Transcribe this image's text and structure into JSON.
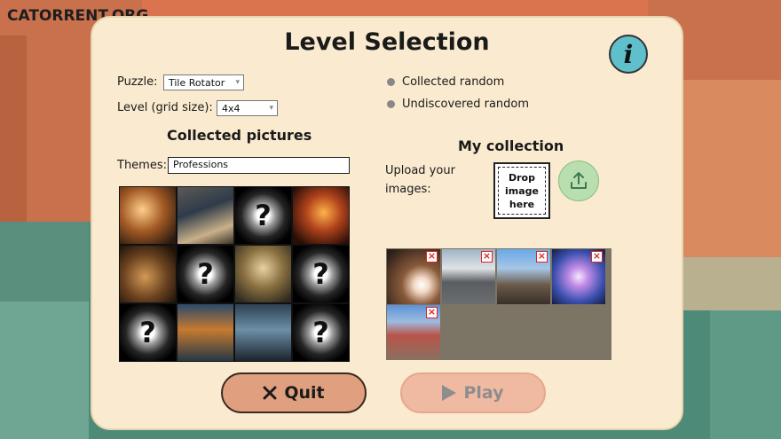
{
  "logo": "CATORRENT.ORG",
  "title": "Level Selection",
  "info_icon": "i",
  "puzzle": {
    "label": "Puzzle:",
    "value": "Tile Rotator"
  },
  "level": {
    "label": "Level (grid size):",
    "value": "4x4"
  },
  "modes": [
    "Collected random",
    "Undiscovered random"
  ],
  "collected": {
    "title": "Collected pictures",
    "themes_label": "Themes:",
    "themes_value": "Professions",
    "unknown_glyph": "?",
    "cells": [
      "photo",
      "photo",
      "unknown",
      "photo",
      "photo",
      "unknown",
      "photo",
      "unknown",
      "unknown",
      "photo",
      "photo",
      "unknown"
    ]
  },
  "my_collection": {
    "title": "My collection",
    "upload_label_line1": "Upload your",
    "upload_label_line2": "images:",
    "drop_line1": "Drop",
    "drop_line2": "image",
    "drop_line3": "here",
    "thumb_count": 5
  },
  "buttons": {
    "quit": "Quit",
    "play": "Play"
  },
  "icons": {
    "quit": "close-icon",
    "play": "play-icon",
    "upload": "upload-icon",
    "info": "info-icon",
    "remove": "remove-icon"
  }
}
